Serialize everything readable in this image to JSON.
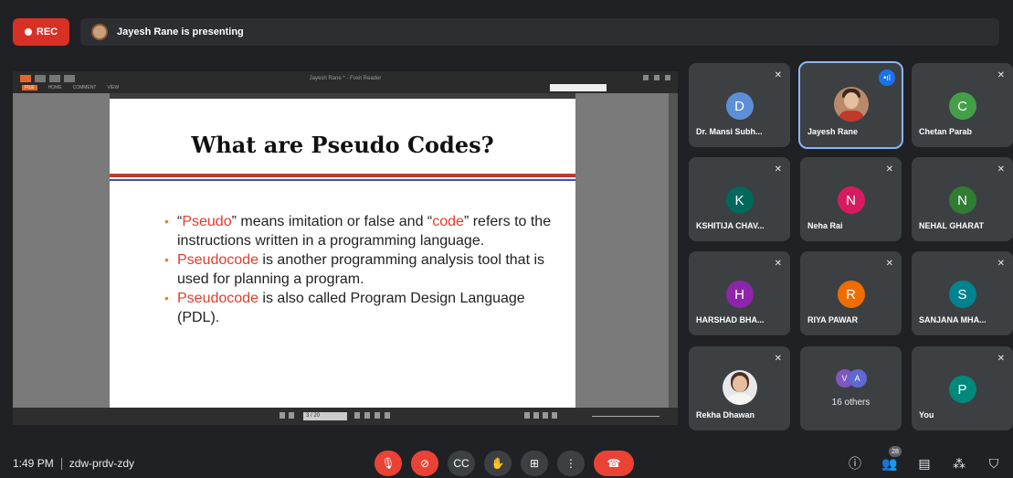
{
  "header": {
    "rec_label": "REC",
    "presenting_text": "Jayesh Rane is presenting"
  },
  "shared_screen": {
    "viewer_title": "Jayesh Rane * - Foxit Reader",
    "viewer_menu": [
      "FILE",
      "HOME",
      "COMMENT",
      "VIEW"
    ],
    "page_indicator": "3 / 20",
    "slide": {
      "title": "What are Pseudo Codes?",
      "bullets": [
        {
          "parts": [
            {
              "text": "“",
              "hl": false
            },
            {
              "text": "Pseudo",
              "hl": true
            },
            {
              "text": "” means imitation or false and “",
              "hl": false
            },
            {
              "text": "code",
              "hl": true
            },
            {
              "text": "” refers to the instructions written in a programming language.",
              "hl": false
            }
          ]
        },
        {
          "parts": [
            {
              "text": "Pseudocode",
              "hl": true
            },
            {
              "text": " is another programming analysis tool that is used for planning a program.",
              "hl": false
            }
          ]
        },
        {
          "parts": [
            {
              "text": "Pseudocode",
              "hl": true
            },
            {
              "text": " is also called Program Design Language (PDL).",
              "hl": false
            }
          ]
        }
      ]
    }
  },
  "participants": [
    {
      "name": "Dr. Mansi Subh...",
      "initial": "D",
      "color": "#5c8fd6",
      "type": "initial",
      "muted": true
    },
    {
      "name": "Jayesh Rane",
      "type": "photo",
      "speaking": true,
      "active": true
    },
    {
      "name": "Chetan Parab",
      "initial": "C",
      "color": "#43a047",
      "type": "initial",
      "muted": true
    },
    {
      "name": "KSHITIJA CHAV...",
      "initial": "K",
      "color": "#00695c",
      "type": "initial",
      "muted": true
    },
    {
      "name": "Neha Rai",
      "initial": "N",
      "color": "#d81b60",
      "type": "initial",
      "muted": true
    },
    {
      "name": "NEHAL GHARAT",
      "initial": "N",
      "color": "#2e7d32",
      "type": "initial",
      "muted": true
    },
    {
      "name": "HARSHAD BHA...",
      "initial": "H",
      "color": "#8e24aa",
      "type": "initial",
      "muted": true
    },
    {
      "name": "RIYA PAWAR",
      "initial": "R",
      "color": "#ef6c00",
      "type": "initial",
      "muted": true
    },
    {
      "name": "SANJANA MHA...",
      "initial": "S",
      "color": "#00838f",
      "type": "initial",
      "muted": true
    },
    {
      "name": "Rekha Dhawan",
      "type": "photo-light",
      "muted": true
    },
    {
      "name": "16 others",
      "type": "others",
      "others_initials": [
        "V",
        "A"
      ],
      "others_colors": [
        "#7e57c2",
        "#5e6ad2"
      ]
    },
    {
      "name": "You",
      "initial": "P",
      "color": "#00897b",
      "type": "initial",
      "muted": true
    }
  ],
  "footer": {
    "time": "1:49 PM",
    "meeting_code": "zdw-prdv-zdy",
    "controls": [
      {
        "name": "mic-off-button",
        "icon": "mic-off-icon",
        "glyph": "🎙",
        "style": "red"
      },
      {
        "name": "camera-off-button",
        "icon": "camera-off-icon",
        "glyph": "⊘",
        "style": "red"
      },
      {
        "name": "captions-button",
        "icon": "captions-icon",
        "glyph": "CC",
        "style": "normal"
      },
      {
        "name": "raise-hand-button",
        "icon": "hand-icon",
        "glyph": "✋",
        "style": "normal"
      },
      {
        "name": "present-button",
        "icon": "present-icon",
        "glyph": "⊞",
        "style": "normal"
      },
      {
        "name": "more-options-button",
        "icon": "more-vert-icon",
        "glyph": "⋮",
        "style": "normal"
      },
      {
        "name": "leave-call-button",
        "icon": "call-end-icon",
        "glyph": "☎",
        "style": "end"
      }
    ],
    "right_icons": [
      {
        "name": "meeting-details-button",
        "icon": "info-icon",
        "glyph": "ⓘ"
      },
      {
        "name": "people-button",
        "icon": "people-icon",
        "glyph": "👥",
        "badge": "28"
      },
      {
        "name": "chat-button",
        "icon": "chat-icon",
        "glyph": "▤"
      },
      {
        "name": "activities-button",
        "icon": "activities-icon",
        "glyph": "⁂"
      },
      {
        "name": "host-controls-button",
        "icon": "shield-icon",
        "glyph": "⛉"
      }
    ]
  }
}
